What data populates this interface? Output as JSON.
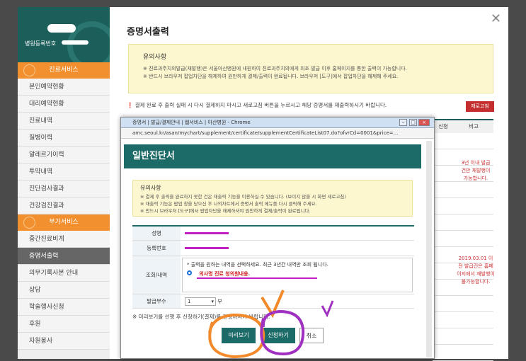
{
  "sidebar": {
    "patient_label": "병원등록번호",
    "section1": "진료서비스",
    "items1": [
      "본인예약현황",
      "대리예약현황",
      "진료내역",
      "질병이력",
      "알레르기이력",
      "투약내역",
      "진단검사결과",
      "건강검진결과"
    ],
    "section2": "부가서비스",
    "items2": [
      "중간진료비계",
      "증명서출력",
      "의무기록사본 안내",
      "상담",
      "학술행사신청",
      "후원",
      "자원봉사"
    ]
  },
  "main": {
    "title": "증명서출력",
    "notice_head": "유의사항",
    "notice_line1": "※ 진료과주치의발급(재발행)은 서울아산병원에 내원하여 진료과주치의에게 최초 발급 이후 홈페이지를 통한 출력이 가능합니다.",
    "notice_line2": "※ 반드시 브라우저 팝업차단을 해제하여 원만하게 결제/출력이 완료됩니다. 브라우저 [도구]에서 팝업차단을 해제해 주세요.",
    "warn": "결제 완료 후 출력 실패 시 다시 결제하지 마시고 새로고침 버튼을 누르시고 해당 증명서를 재출력하시기 바랍니다.",
    "reprint_label": "재로고침",
    "table_header": [
      "신청",
      "비고"
    ],
    "note1": "3년 이내 발급건만 재발행이 가능합니다.",
    "note2": "2019.03.01 이전 발급건은 홈페이지에서 재발행이 불가능합니다.",
    "close": "✕"
  },
  "popup": {
    "window_title": "증명서 | 발급/결제안내 | 웹서비스 | 아산병원 - Chrome",
    "url": "amc.seoul.kr/asan/mychart/supplement/certificate/supplementCertificateList07.do?ofvrCd=0001&price=...",
    "title": "일반진단서",
    "notice_head": "유의사항",
    "notice_lines": [
      "※ 결제 후 출력을 완료하지 못한 건은 재출력 기능을 이용하실 수 있습니다. (보이지 않을 시 화면 새로고침)",
      "※ 재출력 기능은 팝업 창을 닫으신 후 나의차트에서 증명서 출력 메뉴를 다시 클릭해 주세요.",
      "※ 반드시 브라우저 [도구]에서 팝업차단을 해제하셔야 원만하게 결제/출력이 완료됩니다."
    ],
    "labels": {
      "name": "성명",
      "reg": "등록번호",
      "query": "조회/내역",
      "copies": "발급부수"
    },
    "query_hint": "* 출력을 원하는 내역을 선택하세요. 최근 3년간 내역만 조회 됩니다.",
    "query_item": "의사명 진료 청의원내용.",
    "copies_value": "1",
    "copies_unit": "부",
    "hint": "※ 미리보기를 선행 후 신청하기(결제)를 진행하시기 바랍니다.",
    "btn_preview": "미리보기",
    "btn_apply": "신청하기",
    "btn_cancel": "취소"
  }
}
